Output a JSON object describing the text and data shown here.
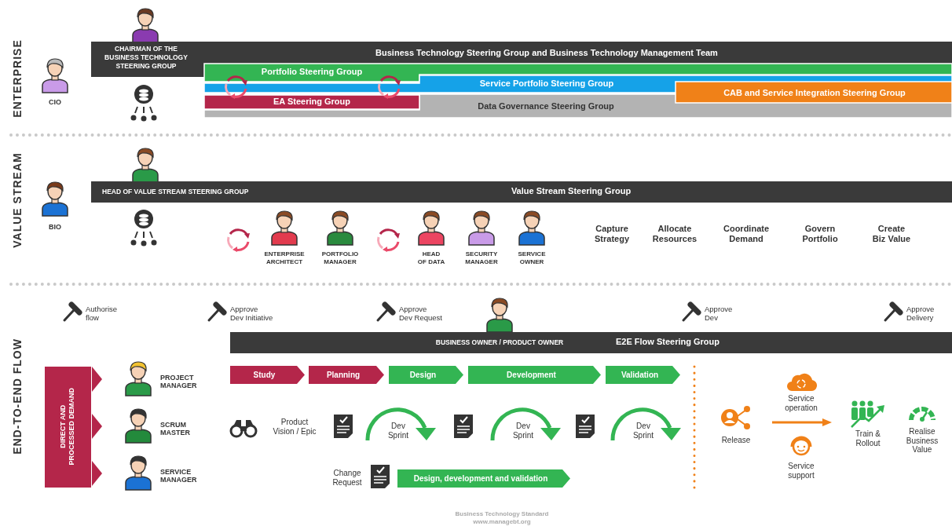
{
  "sections": [
    {
      "label": "ENTERPRISE"
    },
    {
      "label": "VALUE STREAM"
    },
    {
      "label": "END-TO-END FLOW"
    }
  ],
  "enterprise": {
    "cio": "CIO",
    "chair": "CHAIRMAN OF THE\nBUSINESS TECHNOLOGY\nSTEERING GROUP",
    "bar_title": "Business Technology Steering Group and Business Technology Management Team",
    "groups": [
      {
        "label": "Portfolio Steering Group",
        "color": "#33b553"
      },
      {
        "label": "Service Portfolio Steering Group",
        "color": "#15a2e8"
      },
      {
        "label": "Data Governance Steering Group",
        "color": "#b3b3b3"
      },
      {
        "label": "EA Steering Group",
        "color": "#b4264a"
      },
      {
        "label": "CAB and Service Integration Steering Group",
        "color": "#f08118"
      }
    ]
  },
  "value_stream": {
    "bio": "BIO",
    "head_label": "HEAD OF VALUE STREAM STEERING GROUP",
    "bar_title": "Value Stream Steering Group",
    "roles": [
      {
        "label": "ENTERPRISE\nARCHITECT"
      },
      {
        "label": "PORTFOLIO\nMANAGER"
      },
      {
        "label": "HEAD\nOF DATA"
      },
      {
        "label": "SECURITY\nMANAGER"
      },
      {
        "label": "SERVICE\nOWNER"
      }
    ],
    "activities": [
      "Capture\nStrategy",
      "Allocate\nResources",
      "Coordinate\nDemand",
      "Govern\nPortfolio",
      "Create\nBiz Value"
    ]
  },
  "flow": {
    "gates": [
      "Authorise\nflow",
      "Approve\nDev Initiative",
      "Approve\nDev Request",
      "Approve\nDev",
      "Approve\nDelivery"
    ],
    "owner_label": "BUSINESS OWNER / PRODUCT OWNER",
    "bar_title": "E2E Flow Steering Group",
    "demand": "DIRECT AND\nPROCESSED DEMAND",
    "roles": [
      {
        "label": "PROJECT\nMANAGER"
      },
      {
        "label": "SCRUM\nMASTER"
      },
      {
        "label": "SERVICE\nMANAGER"
      }
    ],
    "phases": [
      {
        "label": "Study",
        "color": "#b4264a"
      },
      {
        "label": "Planning",
        "color": "#b4264a"
      },
      {
        "label": "Design",
        "color": "#33b553"
      },
      {
        "label": "Development",
        "color": "#33b553"
      },
      {
        "label": "Validation",
        "color": "#33b553"
      }
    ],
    "pipeline": [
      {
        "kind": "vision",
        "label": "Product\nVision / Epic"
      },
      {
        "kind": "document"
      },
      {
        "kind": "sprint",
        "label": "Dev\nSprint"
      },
      {
        "kind": "document"
      },
      {
        "kind": "sprint",
        "label": "Dev\nSprint"
      },
      {
        "kind": "document"
      },
      {
        "kind": "sprint",
        "label": "Dev\nSprint"
      }
    ],
    "change": {
      "label": "Change\nRequest",
      "bar": "Design, development and validation"
    },
    "operations": [
      {
        "kind": "release",
        "label": "Release"
      },
      {
        "kind": "operation",
        "label": "Service\noperation"
      },
      {
        "kind": "support",
        "label": "Service\nsupport"
      },
      {
        "kind": "train",
        "label": "Train &\nRollout"
      },
      {
        "kind": "value",
        "label": "Realise\nBusiness\nValue"
      }
    ]
  },
  "footer": [
    "Business Technology Standard",
    "www.managebt.org"
  ]
}
